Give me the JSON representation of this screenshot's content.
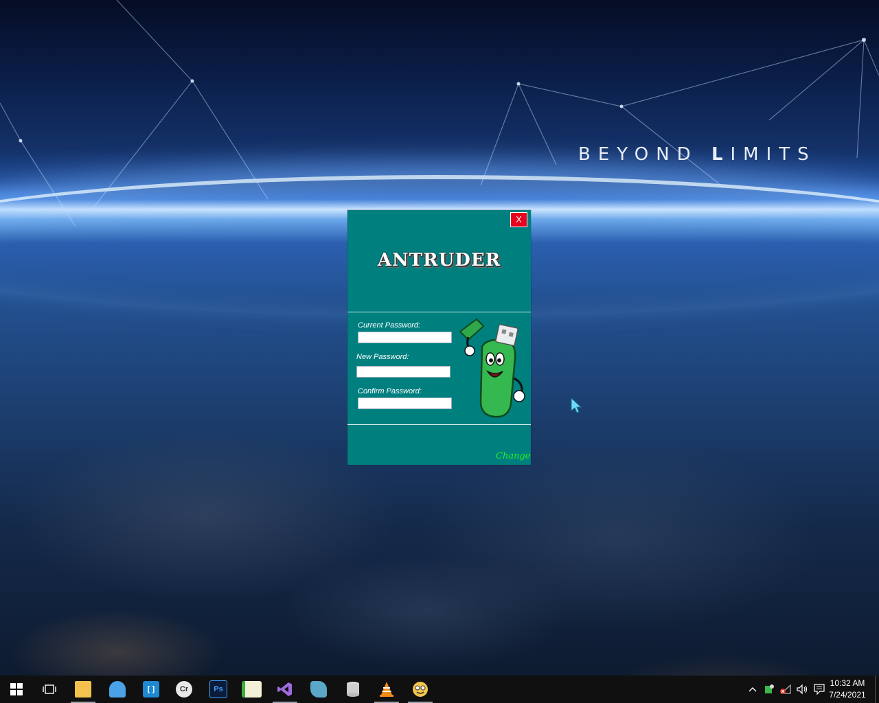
{
  "desktop": {
    "slogan_part1": "BEYOND ",
    "slogan_part2": "L",
    "slogan_part3": "IMITS"
  },
  "app": {
    "logo": "ANTRUDER",
    "close_label": "X",
    "current_password_label": "Current Password:",
    "current_password_value": "",
    "new_password_label": "New Password:",
    "new_password_value": "",
    "confirm_password_label": "Confirm Password:",
    "confirm_password_value": "",
    "change_label": "Change",
    "colors": {
      "background": "#007f7f",
      "close": "#e8001c",
      "change": "#24f024"
    }
  },
  "taskbar": {
    "apps": [
      {
        "name": "file-explorer",
        "icon": "folder-icon",
        "running": true
      },
      {
        "name": "app-cloud",
        "icon": "cloud-app-icon",
        "running": false
      },
      {
        "name": "app-bracket",
        "icon": "bracket-app-icon",
        "running": false
      },
      {
        "name": "app-cr",
        "icon": "cr-app-icon",
        "running": false
      },
      {
        "name": "photoshop",
        "icon": "ps-icon",
        "running": false
      },
      {
        "name": "app-chart",
        "icon": "chart-app-icon",
        "running": false
      },
      {
        "name": "visual-studio",
        "icon": "vs-icon",
        "running": true
      },
      {
        "name": "app-puzzle",
        "icon": "puzzle-app-icon",
        "running": false
      },
      {
        "name": "app-database",
        "icon": "database-icon",
        "running": false
      },
      {
        "name": "vlc",
        "icon": "vlc-icon",
        "running": true
      },
      {
        "name": "app-smiley",
        "icon": "smiley-app-icon",
        "running": true
      }
    ],
    "ps_label": "Ps",
    "cr_label": "Cr",
    "clock_time": "10:32 AM",
    "clock_date": "7/24/2021"
  }
}
